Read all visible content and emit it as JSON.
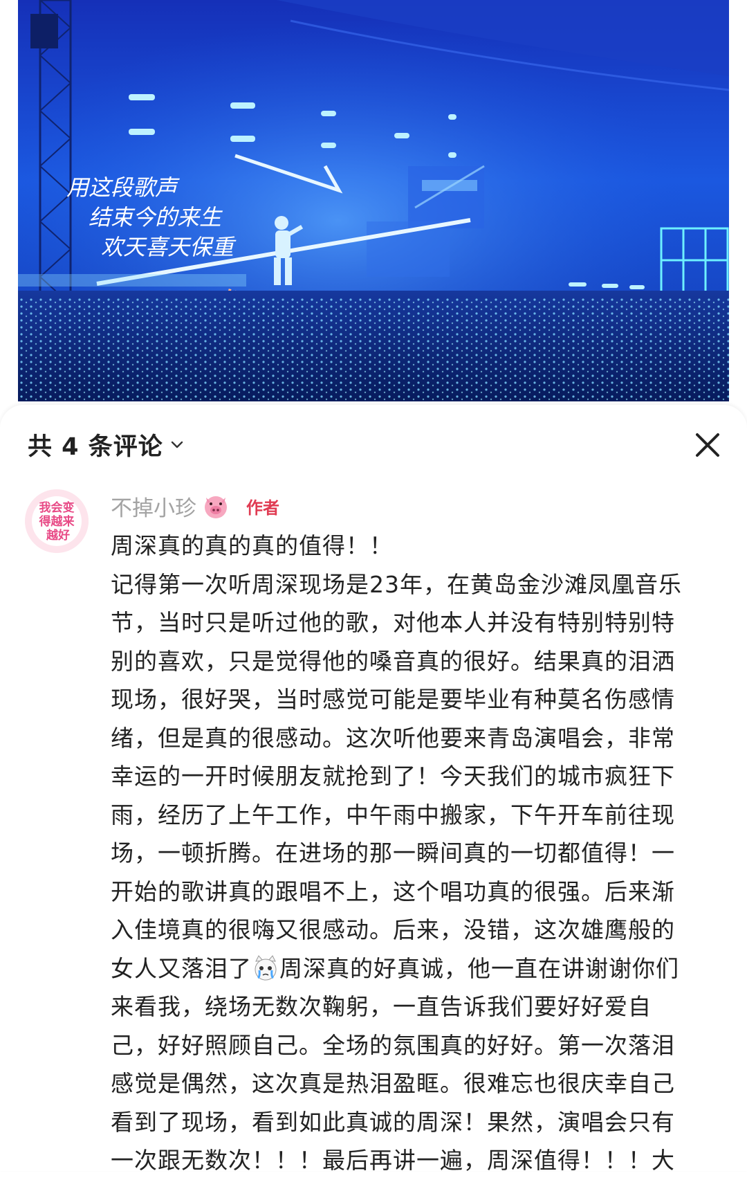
{
  "photo": {
    "description_icon": "concert-photo",
    "lyrics": [
      "用这段歌声",
      "结束今的来生",
      "欢天喜天保重"
    ]
  },
  "comments_sheet": {
    "title": "共 4 条评论",
    "close_icon": "close-icon",
    "chevron_icon": "chevron-down-icon"
  },
  "comment": {
    "avatar_text": [
      "我会变",
      "得越来",
      "越好"
    ],
    "author": "不掉小珍",
    "author_emoji_icon": "pig-face-icon",
    "badge": "作者",
    "lines": [
      "周深真的真的真的值得！！",
      "记得第一次听周深现场是23年，在黄岛金沙滩凤凰音乐",
      "节，当时只是听过他的歌，对他本人并没有特别特别特",
      "别的喜欢，只是觉得他的嗓音真的很好。结果真的泪洒",
      "现场，很好哭，当时感觉可能是要毕业有种莫名伤感情",
      "绪，但是真的很感动。这次听他要来青岛演唱会，非常",
      "幸运的一开时候朋友就抢到了！今天我们的城市疯狂下",
      "雨，经历了上午工作，中午雨中搬家，下午开车前往现",
      "场，一顿折腾。在进场的那一瞬间真的一切都值得！一",
      "开始的歌讲真的跟唱不上，这个唱功真的很强。后来渐",
      "入佳境真的很嗨又很感动。后来，没错，这次雄鹰般的",
      "女人又落泪了",
      "周深真的好真诚，他一直在讲谢谢你们",
      "来看我，绕场无数次鞠躬，一直告诉我们要好好爱自",
      "己，好好照顾自己。全场的氛围真的好好。第一次落泪",
      "感觉是偶然，这次真是热泪盈眶。很难忘也很庆幸自己",
      "看到了现场，看到如此真诚的周深！果然，演唱会只有",
      "一次跟无数次！！！最后再讲一遍，周深值得！！！大"
    ],
    "crying_emoji_icon": "crying-cat-icon"
  },
  "colors": {
    "accent_red": "#e03b52",
    "stage_blue": "#1c4fd8"
  }
}
